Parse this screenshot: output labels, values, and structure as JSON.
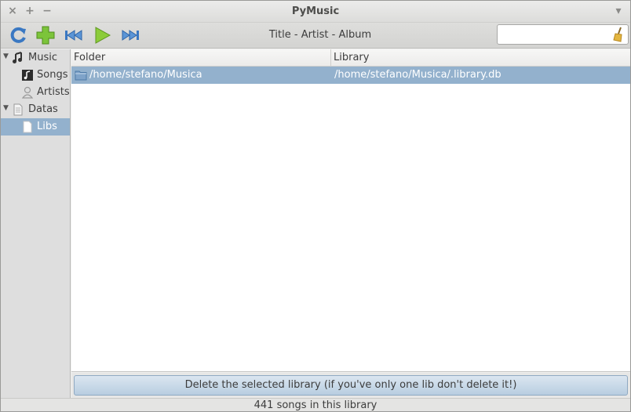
{
  "window": {
    "title": "PyMusic",
    "controls": {
      "close": "×",
      "maximize": "+",
      "minimize": "−",
      "menu": "▾"
    }
  },
  "toolbar": {
    "buttons": [
      "refresh-icon",
      "add-icon",
      "previous-icon",
      "play-icon",
      "next-icon"
    ],
    "now_playing": "Title - Artist - Album",
    "search": {
      "value": "",
      "placeholder": ""
    }
  },
  "sidebar": {
    "music": {
      "label": "Music",
      "expander": "▼"
    },
    "songs": {
      "label": "Songs"
    },
    "artists": {
      "label": "Artists"
    },
    "datas": {
      "label": "Datas",
      "expander": "▼"
    },
    "libs": {
      "label": "Libs"
    }
  },
  "table": {
    "columns": [
      "Folder",
      "Library"
    ],
    "rows": [
      {
        "folder": "/home/stefano/Musica",
        "library": "/home/stefano/Musica/.library.db"
      }
    ]
  },
  "actions": {
    "delete_label": "Delete the selected library (if you've only one lib don't delete it!)"
  },
  "status": {
    "text": "441 songs in this library"
  },
  "colors": {
    "selection": "#93b1cd",
    "accent_blue": "#3a78c2",
    "accent_green": "#6fbf2a"
  }
}
